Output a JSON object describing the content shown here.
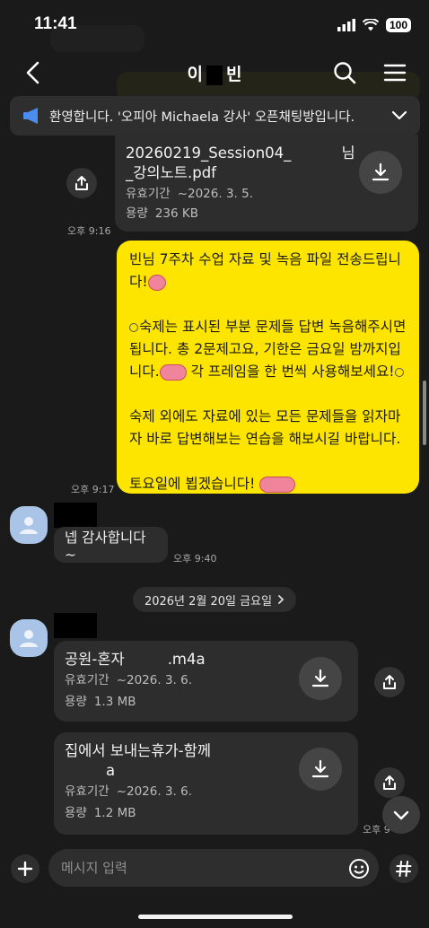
{
  "status_bar": {
    "time": "11:41",
    "battery": "100"
  },
  "header": {
    "title_start": "이",
    "title_end": "빈"
  },
  "notice": {
    "text": "환영합니다. '오피아 Michaela 강사' 오픈채팅방입니다."
  },
  "messages": {
    "file1": {
      "line1": "20260219_Session04_",
      "line1_suffix": "님",
      "line2": "_강의노트.pdf",
      "validity_label": "유효기간",
      "validity_value": "~2026. 3. 5.",
      "size_label": "용량",
      "size_value": "236 KB",
      "time": "오후 9:16"
    },
    "teacher_message": {
      "p1": "빈님 7주차 수업 자료 및 녹음 파일 전송드립니다!",
      "p2a": "숙제는 표시된 부분 문제들 답변 녹음해주시면 됩니다. 총 2문제고요, 기한은 금요일 밤까지입니다.",
      "p2b": "각 프레임을 한 번씩 사용해보세요!",
      "p3": "숙제 외에도 자료에 있는 모든 문제들을 읽자마자 바로 답변해보는 연습을 해보시길 바랍니다.",
      "p4": "토요일에 뵙겠습니다!",
      "time": "오후 9:17"
    },
    "reply": {
      "text": "넵 감사합니다~",
      "time": "오후 9:40"
    },
    "date_divider": "2026년 2월 20일 금요일",
    "file2": {
      "name": "공원-혼자",
      "ext": ".m4a",
      "validity_label": "유효기간",
      "validity_value": "~2026. 3. 6.",
      "size_label": "용량",
      "size_value": "1.3 MB"
    },
    "file3": {
      "line1": "집에서 보내는휴가-함께",
      "line2": "a",
      "validity_label": "유효기간",
      "validity_value": "~2026. 3. 6.",
      "size_label": "용량",
      "size_value": "1.2 MB",
      "time": "오후 9"
    }
  },
  "input": {
    "placeholder": "메시지 입력"
  },
  "icons": {
    "back": "chevron-left-icon",
    "search": "search-icon",
    "menu": "hamburger-icon",
    "notice": "megaphone-icon",
    "expand": "chevron-down-icon",
    "download": "download-icon",
    "share": "share-icon",
    "add": "plus-icon",
    "emoji": "emoji-icon",
    "hash": "hash-icon"
  },
  "colors": {
    "background": "#1a1a1a",
    "my_bubble": "#fee500",
    "other_bubble": "#2d2d2d",
    "notice_icon": "#4a8cf0"
  }
}
